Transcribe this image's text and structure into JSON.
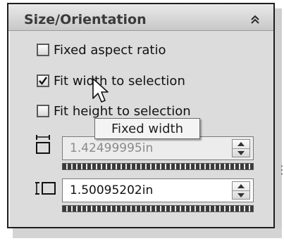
{
  "panel": {
    "title": "Size/Orientation",
    "collapse_icon": "double-chevron-up-icon"
  },
  "options": [
    {
      "label": "Fixed aspect ratio",
      "checked": false
    },
    {
      "label": "Fit width to selection",
      "checked": true
    },
    {
      "label": "Fit height to selection",
      "checked": false
    }
  ],
  "tooltip": {
    "text": "Fixed width"
  },
  "width_field": {
    "value": "1.42499995in",
    "enabled": false,
    "icon": "fixed-width-icon"
  },
  "height_field": {
    "value": "1.50095202in",
    "enabled": true,
    "icon": "fixed-height-icon"
  },
  "colors": {
    "panel_bg": "#dcdcdc",
    "border": "#1e1e1e"
  }
}
